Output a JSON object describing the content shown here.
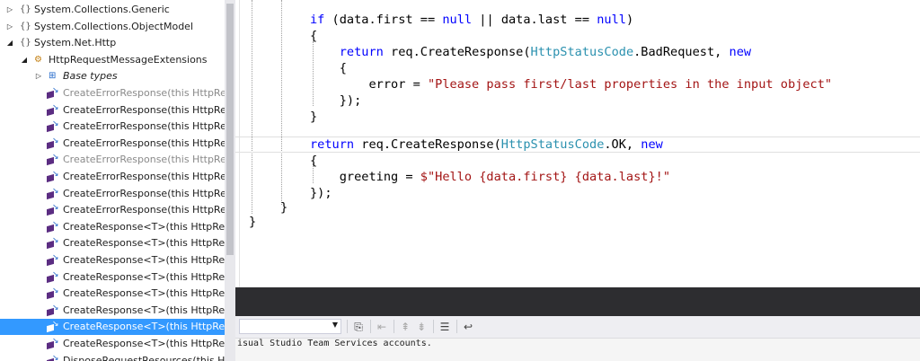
{
  "tree": {
    "nodes": [
      {
        "label": "System.Collections.Generic",
        "expander": "collapsed",
        "icon": "namespace-icon",
        "style": "normal"
      },
      {
        "label": "System.Collections.ObjectModel",
        "expander": "collapsed",
        "icon": "namespace-icon",
        "style": "normal"
      },
      {
        "label": "System.Net.Http",
        "expander": "expanded",
        "icon": "namespace-icon",
        "style": "normal"
      },
      {
        "label": "HttpRequestMessageExtensions",
        "expander": "expanded",
        "icon": "class-icon",
        "style": "normal"
      },
      {
        "label": "Base types",
        "expander": "collapsed",
        "icon": "base-types-icon",
        "style": "italic"
      },
      {
        "label": "CreateErrorResponse(this HttpReque",
        "icon": "extension-method-icon",
        "style": "gray"
      },
      {
        "label": "CreateErrorResponse(this HttpReque",
        "icon": "extension-method-icon",
        "style": "normal"
      },
      {
        "label": "CreateErrorResponse(this HttpReque",
        "icon": "extension-method-icon",
        "style": "normal"
      },
      {
        "label": "CreateErrorResponse(this HttpReque",
        "icon": "extension-method-icon",
        "style": "normal"
      },
      {
        "label": "CreateErrorResponse(this HttpReque",
        "icon": "extension-method-icon",
        "style": "gray"
      },
      {
        "label": "CreateErrorResponse(this HttpReque",
        "icon": "extension-method-icon",
        "style": "normal"
      },
      {
        "label": "CreateErrorResponse(this HttpReque",
        "icon": "extension-method-icon",
        "style": "normal"
      },
      {
        "label": "CreateErrorResponse(this HttpReque",
        "icon": "extension-method-icon",
        "style": "normal"
      },
      {
        "label": "CreateResponse<T>(this HttpReque",
        "icon": "extension-method-icon",
        "style": "normal"
      },
      {
        "label": "CreateResponse<T>(this HttpReque",
        "icon": "extension-method-icon",
        "style": "normal"
      },
      {
        "label": "CreateResponse<T>(this HttpReque",
        "icon": "extension-method-icon",
        "style": "normal"
      },
      {
        "label": "CreateResponse<T>(this HttpReque",
        "icon": "extension-method-icon",
        "style": "normal"
      },
      {
        "label": "CreateResponse<T>(this HttpReque",
        "icon": "extension-method-icon",
        "style": "normal"
      },
      {
        "label": "CreateResponse<T>(this HttpReque",
        "icon": "extension-method-icon",
        "style": "normal"
      },
      {
        "label": "CreateResponse<T>(this HttpReque",
        "icon": "extension-method-icon",
        "style": "selected"
      },
      {
        "label": "CreateResponse<T>(this HttpReque",
        "icon": "extension-method-icon",
        "style": "normal"
      },
      {
        "label": "DisposeRequestResources(this HttpR",
        "icon": "extension-method-icon",
        "style": "normal"
      }
    ]
  },
  "editor": {
    "lines": [
      [
        {
          "t": "if",
          "c": "kw"
        },
        {
          "t": " (data.first == "
        },
        {
          "t": "null",
          "c": "kw"
        },
        {
          "t": " || data.last == "
        },
        {
          "t": "null",
          "c": "kw"
        },
        {
          "t": ")"
        }
      ],
      [
        {
          "t": "{"
        }
      ],
      [
        {
          "t": "    "
        },
        {
          "t": "return",
          "c": "kw"
        },
        {
          "t": " req.CreateResponse("
        },
        {
          "t": "HttpStatusCode",
          "c": "ty"
        },
        {
          "t": ".BadRequest, "
        },
        {
          "t": "new",
          "c": "kw"
        }
      ],
      [
        {
          "t": "    {"
        }
      ],
      [
        {
          "t": "        error = "
        },
        {
          "t": "\"Please pass first/last properties in the input object\"",
          "c": "str"
        }
      ],
      [
        {
          "t": "    });"
        }
      ],
      [
        {
          "t": "}"
        }
      ],
      [
        {
          "t": ""
        }
      ],
      [
        {
          "t": "return",
          "c": "kw"
        },
        {
          "t": " req.CreateResponse("
        },
        {
          "t": "HttpStatusCode",
          "c": "ty"
        },
        {
          "t": ".OK, "
        },
        {
          "t": "new",
          "c": "kw"
        }
      ],
      [
        {
          "t": "{"
        }
      ],
      [
        {
          "t": "    greeting = "
        },
        {
          "t": "$\"Hello {data.first} {data.last}!\"",
          "c": "str"
        }
      ],
      [
        {
          "t": "});"
        }
      ]
    ],
    "close_inner": "}",
    "close_outer": "}"
  },
  "output": {
    "line1": "isual Studio Team Services accounts.",
    "line2": ""
  },
  "colors": {
    "keyword": "#0000ff",
    "type": "#2b91af",
    "string": "#a31515",
    "selection": "#3399ff",
    "splitter": "#2d2d30"
  }
}
